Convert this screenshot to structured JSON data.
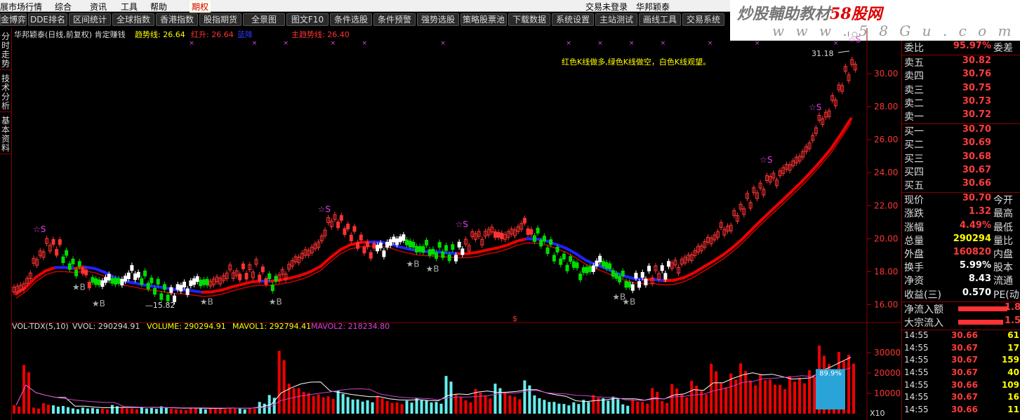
{
  "menubar": {
    "items": [
      "展市场行情",
      "综合",
      "资讯",
      "工具",
      "帮助",
      "期权"
    ],
    "login": "交易未登录",
    "stock": "华邦颖泰"
  },
  "toolbar": [
    "金博弈",
    "DDE排名",
    "区间统计",
    "全球指数",
    "香港指数",
    "股指期货",
    "全景图",
    "图文F10",
    "条件选股",
    "条件预警",
    "强势选股",
    "策略股票池",
    "下载数据",
    "系统设置",
    "主站测试",
    "画线工具",
    "交易系统"
  ],
  "watermark": {
    "text_a": "炒股輔助教材",
    "text_b": "58股网",
    "url": "w w w . 5 8 G u . c o m"
  },
  "sidetabs": [
    "分时走势",
    "技术分析",
    "基本资料"
  ],
  "chart_legend": {
    "title": "华邦颖泰(日线,前复权) 肯定赚钱",
    "trend_label": "趋势线: 26.64",
    "red_label": "红升: 26.64",
    "blue_label": "蓝降",
    "main_trend": "主趋势线: 26.40",
    "note": "红色K线做多,绿色K线做空，白色K线观望。"
  },
  "vol_legend": {
    "name": "VOL-TDX(5,10)",
    "vvol": "VVOL: 290294.91",
    "volume": "VOLUME: 290294.91",
    "mavol1": "MAVOL1: 292794.41",
    "mavol2": "MAVOL2: 218234.80"
  },
  "chart_data": {
    "type": "candlestick",
    "price_axis": [
      16.0,
      18.0,
      20.0,
      22.0,
      24.0,
      26.0,
      28.0,
      30.0
    ],
    "vol_axis": [
      10000,
      20000,
      30000
    ],
    "ylim": [
      15.0,
      32.0
    ],
    "high_label": "31.18",
    "low_label": "15.82",
    "vol_badge": "89.9%",
    "vol_unit": "X10",
    "markers": {
      "buy": "★B",
      "sell": "☆S"
    },
    "closes": [
      17.0,
      17.8,
      19.2,
      19.6,
      19.4,
      18.6,
      18.2,
      17.6,
      17.2,
      17.6,
      17.4,
      17.8,
      17.9,
      17.3,
      17.0,
      16.7,
      16.8,
      17.2,
      17.4,
      17.3,
      17.5,
      17.8,
      18.0,
      17.9,
      18.2,
      17.7,
      17.3,
      18.1,
      18.6,
      19.1,
      19.5,
      20.4,
      21.4,
      20.6,
      20.2,
      19.6,
      19.3,
      19.5,
      19.8,
      20.0,
      19.6,
      19.4,
      19.3,
      19.2,
      19.1,
      19.5,
      20.0,
      20.2,
      20.4,
      20.1,
      20.4,
      20.8,
      20.5,
      19.9,
      19.4,
      18.9,
      18.5,
      18.1,
      18.0,
      18.7,
      18.3,
      17.6,
      17.3,
      17.4,
      17.8,
      18.0,
      18.2,
      18.5,
      18.7,
      19.3,
      19.9,
      20.3,
      20.7,
      21.4,
      22.2,
      22.9,
      23.4,
      23.8,
      24.2,
      24.7,
      25.4,
      26.6,
      27.6,
      28.4,
      29.9,
      30.7
    ],
    "volumes": [
      4200,
      24000,
      3000,
      5200,
      4100,
      3800,
      2600,
      3000,
      2800,
      2500,
      4300,
      3100,
      2600,
      3000,
      2800,
      3600,
      2500,
      2000,
      3100,
      2500,
      2800,
      2600,
      3000,
      2500,
      2800,
      5800,
      9200,
      31000,
      14800,
      12600,
      10200,
      9500,
      8600,
      11400,
      8200,
      7000,
      6600,
      8800,
      6200,
      5500,
      6400,
      7800,
      6500,
      5800,
      18600,
      9800,
      6600,
      12200,
      8800,
      14800,
      10600,
      8400,
      16400,
      9000,
      6800,
      5800,
      4800,
      5600,
      6800,
      9200,
      7600,
      8400,
      4600,
      7000,
      5800,
      12600,
      6200,
      14600,
      9400,
      16200,
      11200,
      24600,
      15200,
      19800,
      24800,
      16400,
      19400,
      16800,
      14200,
      18600,
      17600,
      21400,
      33600,
      24400,
      30400,
      29029
    ]
  },
  "quote": {
    "weibi": {
      "label": "委比",
      "value": "95.97%",
      "label2": "委差"
    },
    "asks": [
      {
        "label": "卖五",
        "price": "30.82"
      },
      {
        "label": "卖四",
        "price": "30.76"
      },
      {
        "label": "卖三",
        "price": "30.75"
      },
      {
        "label": "卖二",
        "price": "30.73"
      },
      {
        "label": "卖一",
        "price": "30.72"
      }
    ],
    "bids": [
      {
        "label": "买一",
        "price": "30.70"
      },
      {
        "label": "买二",
        "price": "30.69"
      },
      {
        "label": "买三",
        "price": "30.68"
      },
      {
        "label": "买四",
        "price": "30.67"
      },
      {
        "label": "买五",
        "price": "30.66"
      }
    ],
    "stats": [
      {
        "label": "现价",
        "value": "30.70",
        "label2": "今开",
        "color": "red"
      },
      {
        "label": "涨跌",
        "value": "1.32",
        "label2": "最高",
        "color": "red"
      },
      {
        "label": "涨幅",
        "value": "4.49%",
        "label2": "最低",
        "color": "red"
      },
      {
        "label": "总量",
        "value": "290294",
        "label2": "量比",
        "color": "yel"
      },
      {
        "label": "外盘",
        "value": "160820",
        "label2": "内盘",
        "color": "red"
      },
      {
        "label": "换手",
        "value": "5.99%",
        "label2": "股本",
        "color": "white"
      },
      {
        "label": "净资",
        "value": "8.43",
        "label2": "流通",
        "color": "white"
      },
      {
        "label": "收益(三)",
        "value": "0.570",
        "label2": "PE(动)",
        "color": "white"
      }
    ],
    "flows": [
      {
        "label": "净流入额",
        "value": "1.8"
      },
      {
        "label": "大宗流入",
        "value": "1.5"
      }
    ],
    "ticks": [
      {
        "time": "14:55",
        "price": "30.66",
        "vol": "61"
      },
      {
        "time": "14:55",
        "price": "30.67",
        "vol": "17"
      },
      {
        "time": "14:55",
        "price": "30.67",
        "vol": "159"
      },
      {
        "time": "14:55",
        "price": "30.67",
        "vol": "40"
      },
      {
        "time": "14:55",
        "price": "30.66",
        "vol": "109"
      },
      {
        "time": "14:55",
        "price": "30.67",
        "vol": "16"
      },
      {
        "time": "14:55",
        "price": "30.66",
        "vol": "11"
      }
    ]
  }
}
